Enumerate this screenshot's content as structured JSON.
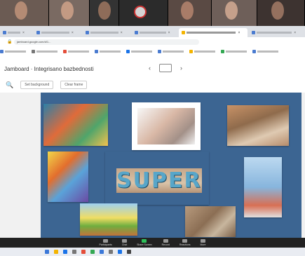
{
  "video_strip": {
    "participants": [
      {
        "face": "#b48b74",
        "bg": "#6b5b53",
        "w": 70
      },
      {
        "face": "#c39a83",
        "bg": "#7a6a62",
        "w": 58
      },
      {
        "face": "#8e6c59",
        "bg": "#333",
        "w": 42
      },
      {
        "face": "#d4d4d4",
        "bg": "#2b2b2b",
        "w": 70,
        "logo": true
      },
      {
        "face": "#a87c68",
        "bg": "#5a4a44",
        "w": 62
      },
      {
        "face": "#c5a08b",
        "bg": "#6e5f59",
        "w": 65
      },
      {
        "face": "#94705e",
        "bg": "#3d3330",
        "w": 68
      }
    ]
  },
  "browser": {
    "tabs": [
      {
        "color": "#4a7bd0",
        "active": false,
        "w": 38
      },
      {
        "color": "#4a7bd0",
        "active": false,
        "w": 60
      },
      {
        "color": "#4a7bd0",
        "active": false,
        "w": 60
      },
      {
        "color": "#4a7bd0",
        "active": false,
        "w": 58
      },
      {
        "color": "#f4b400",
        "active": true,
        "w": 90
      },
      {
        "color": "#4a7bd0",
        "active": false,
        "w": 70
      }
    ],
    "url": "jamboard.google.com/d/1...",
    "bookmarks": [
      {
        "color": "#4a7bd0"
      },
      {
        "color": "#777"
      },
      {
        "color": "#e44d3a"
      },
      {
        "color": "#4a7bd0"
      },
      {
        "color": "#1a73e8"
      },
      {
        "color": "#4a7bd0"
      },
      {
        "color": "#f4b400"
      },
      {
        "color": "#34a853"
      },
      {
        "color": "#4a7bd0"
      }
    ]
  },
  "app": {
    "title": "Jamboard · Integrisano bazbednosti",
    "page_indicator_prev": "‹",
    "page_indicator_next": "›",
    "toolbar": {
      "set_background": "Set background",
      "clear_frame": "Clear frame"
    }
  },
  "board": {
    "color": "#3c6592",
    "images": [
      {
        "name": "superhero-painting",
        "bg": "linear-gradient(135deg,#2c7fa8,#e06b3a 40%,#4fa56b 70%,#f2c14e)"
      },
      {
        "name": "hand-figure-photo",
        "bg": "linear-gradient(135deg,#f7f7f7,#d9b8a6 45%,#a39088 75%,#f1f1f1)"
      },
      {
        "name": "child-drawing-photo",
        "bg": "linear-gradient(160deg,#c89267,#8f6b4c 40%,#dfcab2 70%,#b58b6b)"
      },
      {
        "name": "rainbow-hero-drawing",
        "bg": "linear-gradient(135deg,#f1d74a,#e36e2d 35%,#5aa3d9 60%,#6a4aa3)"
      },
      {
        "name": "super-wall-text",
        "bg": "linear-gradient(180deg,#c7a78a,#d9c3a8 60%,#b69477)"
      },
      {
        "name": "city-drawing",
        "bg": "linear-gradient(180deg,#bcd9f0,#87b5dd 50%,#d86f54 80%,#e0e0e0)"
      },
      {
        "name": "sunflower-drawing",
        "bg": "linear-gradient(180deg,#9ed0f0,#f0dd63 45%,#6fae3f 70%,#c2733c)"
      },
      {
        "name": "cracked-ground-photo",
        "bg": "linear-gradient(135deg,#b79a7d,#8b6e54 45%,#c8b69e 70%,#7a5f47)"
      }
    ],
    "super_text": "SUPER"
  },
  "meeting_bar": {
    "buttons": [
      {
        "label": "Participants",
        "kind": "gray"
      },
      {
        "label": "Chat",
        "kind": "gray"
      },
      {
        "label": "Share Screen",
        "kind": "green"
      },
      {
        "label": "Record",
        "kind": "gray"
      },
      {
        "label": "Reactions",
        "kind": "gray"
      },
      {
        "label": "More",
        "kind": "gray"
      }
    ]
  },
  "taskbar": {
    "icons": [
      "#3b78d8",
      "#f4b400",
      "#1a73e8",
      "#777",
      "#e44d3a",
      "#34a853",
      "#3b78d8",
      "#777",
      "#1a73e8",
      "#444"
    ]
  }
}
